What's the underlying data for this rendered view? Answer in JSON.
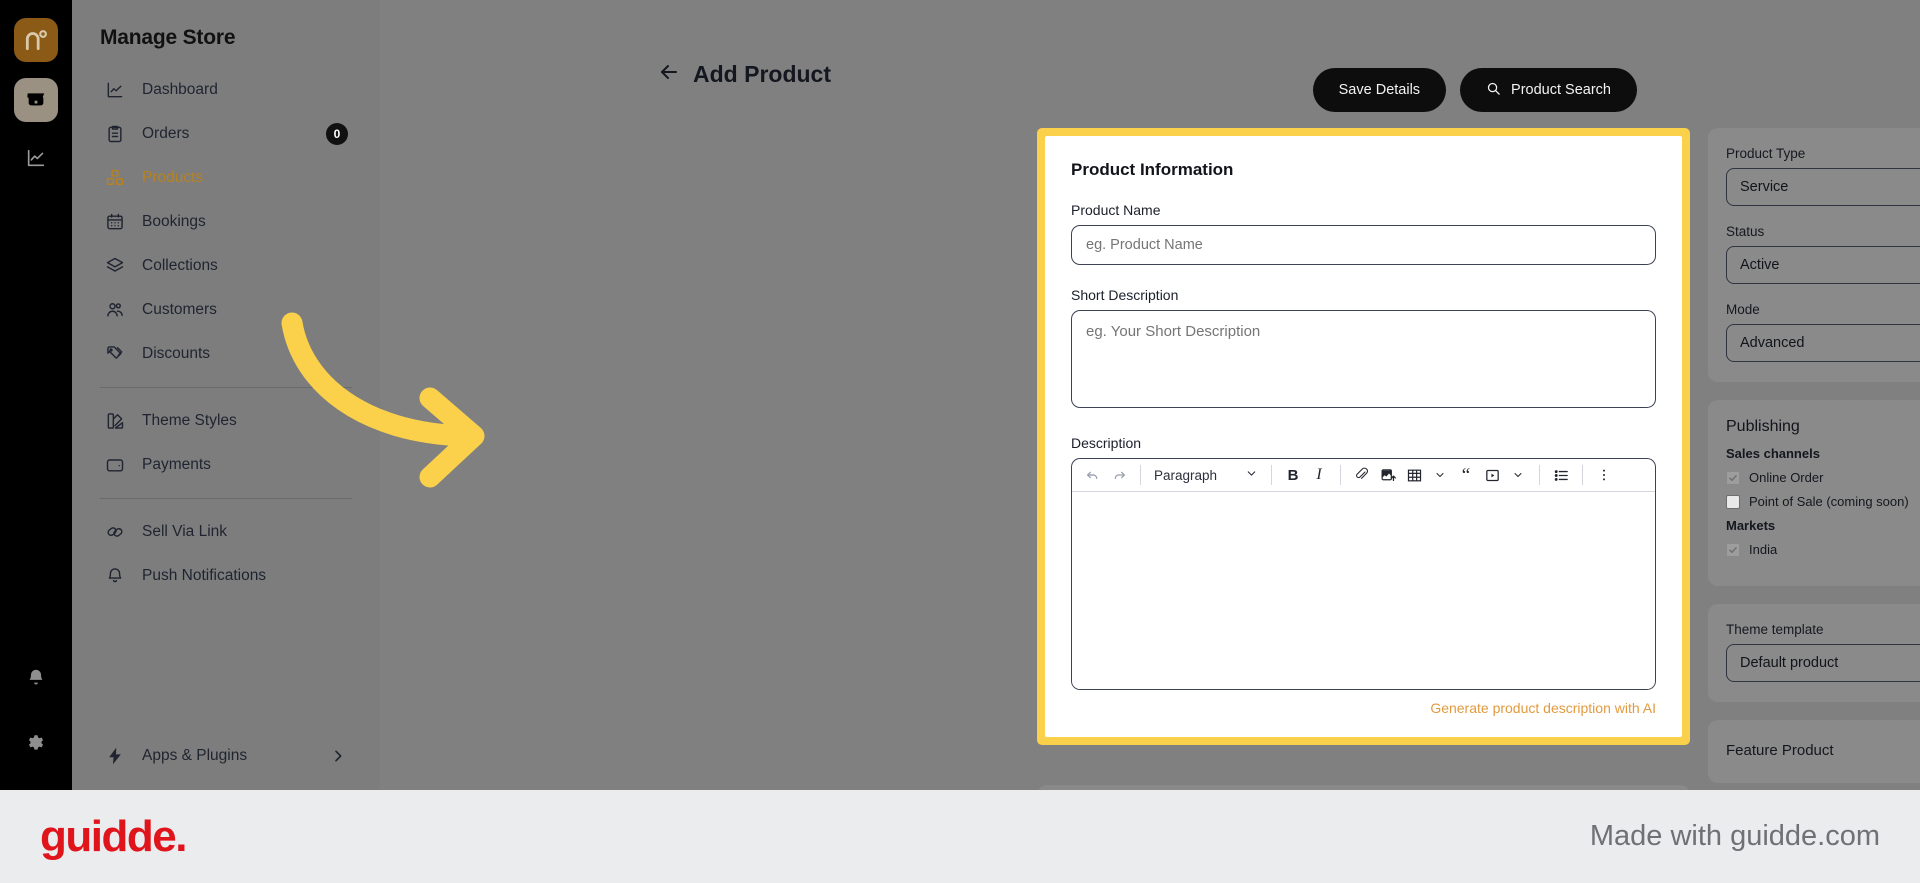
{
  "rail": {
    "logo_icon": "nuo-logo-icon",
    "items": [
      {
        "icon": "storefront-icon",
        "active": true
      },
      {
        "icon": "analytics-chart-icon",
        "active": false
      }
    ],
    "bottom": [
      {
        "icon": "bell-icon"
      },
      {
        "icon": "gear-icon"
      }
    ]
  },
  "sidebar": {
    "title": "Manage Store",
    "groups": [
      [
        {
          "label": "Dashboard",
          "icon": "chart-line-icon",
          "badge": null,
          "current": false
        },
        {
          "label": "Orders",
          "icon": "clipboard-icon",
          "badge": "0",
          "current": false
        },
        {
          "label": "Products",
          "icon": "boxes-icon",
          "badge": null,
          "current": true
        },
        {
          "label": "Bookings",
          "icon": "calendar-icon",
          "badge": null,
          "current": false
        },
        {
          "label": "Collections",
          "icon": "layers-icon",
          "badge": null,
          "current": false
        },
        {
          "label": "Customers",
          "icon": "users-icon",
          "badge": null,
          "current": false
        },
        {
          "label": "Discounts",
          "icon": "tag-icon",
          "badge": null,
          "current": false
        }
      ],
      [
        {
          "label": "Theme Styles",
          "icon": "palette-icon",
          "badge": null,
          "current": false
        },
        {
          "label": "Payments",
          "icon": "wallet-icon",
          "badge": null,
          "current": false
        }
      ],
      [
        {
          "label": "Sell Via Link",
          "icon": "link-icon",
          "badge": null,
          "current": false
        },
        {
          "label": "Push Notifications",
          "icon": "bell-icon",
          "badge": null,
          "current": false
        }
      ]
    ],
    "apps": {
      "label": "Apps & Plugins",
      "icon": "bolt-icon",
      "chevron": "chevron-right-icon"
    }
  },
  "header": {
    "back_icon": "arrow-left-icon",
    "title": "Add Product",
    "save_label": "Save Details",
    "search_label": "Product Search",
    "search_icon": "search-icon"
  },
  "product_card": {
    "heading": "Product Information",
    "name_label": "Product Name",
    "name_value": "",
    "name_placeholder": "eg. Product Name",
    "short_desc_label": "Short Description",
    "short_desc_value": "",
    "short_desc_placeholder": "eg. Your Short Description",
    "description_label": "Description",
    "editor": {
      "undo_icon": "undo-icon",
      "redo_icon": "redo-icon",
      "block_format": "Paragraph",
      "bold_label": "B",
      "italic_label": "I",
      "link_icon": "link-attachment-icon",
      "image_icon": "image-upload-icon",
      "table_icon": "table-icon",
      "quote_icon": "blockquote-icon",
      "embed_icon": "video-embed-icon",
      "list_icon": "bullet-list-icon",
      "more_icon": "more-vertical-icon",
      "content": ""
    },
    "ai_link": "Generate product description with AI"
  },
  "settings": {
    "product_type_label": "Product Type",
    "product_type_value": "Service",
    "status_label": "Status",
    "status_value": "Active",
    "mode_label": "Mode",
    "mode_value": "Advanced",
    "publishing_heading": "Publishing",
    "sales_channels_heading": "Sales channels",
    "sales_channels": [
      {
        "label": "Online Order",
        "checked": true
      },
      {
        "label": "Point of Sale (coming soon)",
        "checked": false
      }
    ],
    "markets_heading": "Markets",
    "markets": [
      {
        "label": "India",
        "checked": true
      }
    ],
    "theme_template_label": "Theme template",
    "theme_template_value": "Default product",
    "feature_product_label": "Feature Product",
    "feature_product_on": false
  },
  "footer": {
    "brand": "guidde.",
    "made_with": "Made with guidde.com"
  },
  "colors": {
    "highlight": "#FBD04B",
    "arrow": "#FBD04B",
    "accent_orange": "#E39A3F",
    "active_nav": "#B8821F",
    "brand_red": "#E0141B"
  }
}
